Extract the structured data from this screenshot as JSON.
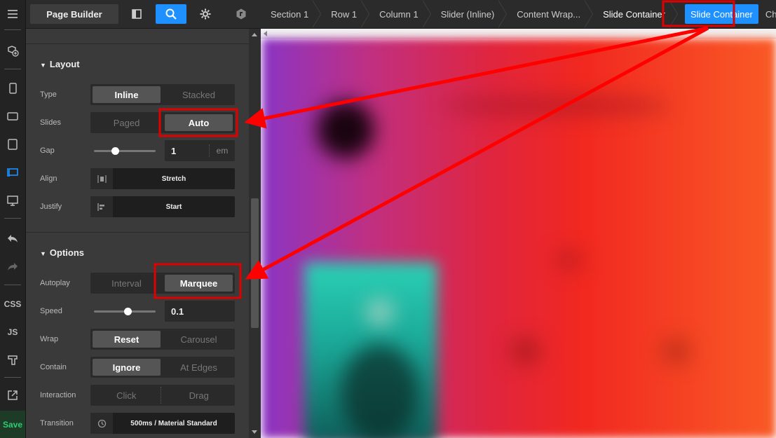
{
  "toolbar": {
    "page_builder_label": "Page Builder"
  },
  "breadcrumb": {
    "items": [
      "Section 1",
      "Row 1",
      "Column 1",
      "Slider (Inline)",
      "Content Wrap...",
      "Slide Container"
    ],
    "active": "Slide Container",
    "children": "Children"
  },
  "rail": {
    "css_label": "CSS",
    "js_label": "JS",
    "save_label": "Save"
  },
  "layout": {
    "heading": "Layout",
    "type": {
      "label": "Type",
      "options": [
        "Inline",
        "Stacked"
      ],
      "selected": "Inline"
    },
    "slides": {
      "label": "Slides",
      "options": [
        "Paged",
        "Auto"
      ],
      "selected": "Auto"
    },
    "gap": {
      "label": "Gap",
      "value": "1",
      "unit": "em",
      "slider_fraction": 0.35
    },
    "align": {
      "label": "Align",
      "value": "Stretch"
    },
    "justify": {
      "label": "Justify",
      "value": "Start"
    }
  },
  "options": {
    "heading": "Options",
    "autoplay": {
      "label": "Autoplay",
      "options": [
        "Interval",
        "Marquee"
      ],
      "selected": "Marquee"
    },
    "speed": {
      "label": "Speed",
      "value": "0.1",
      "slider_fraction": 0.55
    },
    "wrap": {
      "label": "Wrap",
      "options": [
        "Reset",
        "Carousel"
      ],
      "selected": "Reset"
    },
    "contain": {
      "label": "Contain",
      "options": [
        "Ignore",
        "At Edges"
      ],
      "selected": "Ignore"
    },
    "interaction": {
      "label": "Interaction",
      "options": [
        "Click",
        "Drag"
      ],
      "selected": ""
    },
    "transition": {
      "label": "Transition",
      "value": "500ms / Material Standard"
    }
  },
  "colors": {
    "accent": "#1e90ff",
    "annotation": "#ff0000",
    "save": "#2ecc71"
  }
}
